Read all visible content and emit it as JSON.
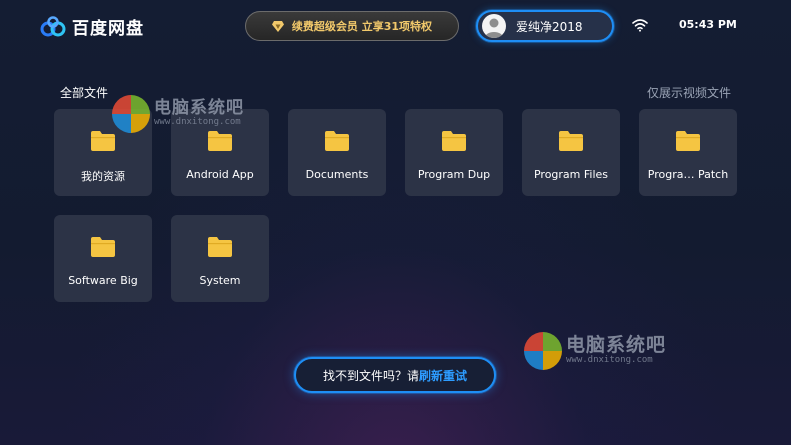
{
  "app": {
    "name": "百度网盘"
  },
  "header": {
    "vip_banner": "续费超级会员 立享31项特权",
    "user_name": "爱纯净2018",
    "time": "05:43 PM"
  },
  "section": {
    "title": "全部文件",
    "filter_label": "仅展示视频文件"
  },
  "folders": [
    {
      "name": "我的资源"
    },
    {
      "name": "Android App"
    },
    {
      "name": "Documents"
    },
    {
      "name": "Program Dup"
    },
    {
      "name": "Program Files"
    },
    {
      "name": "Progra… Patch"
    },
    {
      "name": "Software Big"
    },
    {
      "name": "System"
    }
  ],
  "footer": {
    "prompt": "找不到文件吗？请",
    "action": "刷新重试"
  },
  "watermark": {
    "name": "电脑系统吧",
    "url": "www.dnxitong.com"
  },
  "colors": {
    "accent": "#1e8ef5",
    "folder": "#f5c542",
    "tile": "#2c3346",
    "vip_gold": "#f2c96b"
  },
  "icons": [
    "baidu-netdisk-logo-icon",
    "diamond-icon",
    "avatar-icon",
    "wifi-icon",
    "folder-icon"
  ]
}
